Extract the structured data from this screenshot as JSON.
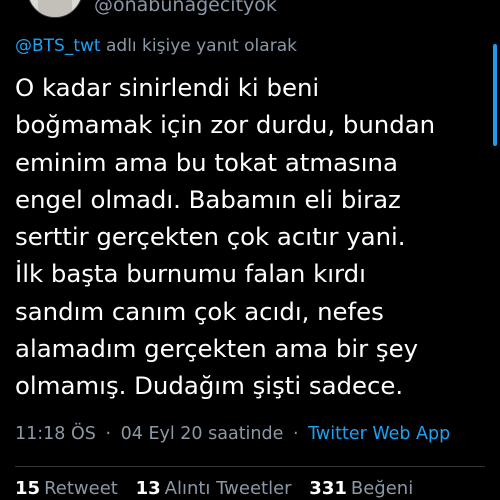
{
  "author": {
    "handle": "@onabunagecityok"
  },
  "reply": {
    "mention": "@BTS_twt",
    "suffix": " adlı kişiye yanıt olarak"
  },
  "tweet": {
    "lines": [
      "O kadar sinirlendi ki beni",
      "boğmamak için zor durdu, bundan",
      "eminim ama bu tokat atmasına",
      "engel olmadı. Babamın eli biraz",
      "serttir gerçekten çok acıtır yani.",
      "İlk başta burnumu falan kırdı",
      "sandım canım çok acıdı, nefes",
      "alamadım gerçekten ama bir şey",
      "olmamış. Dudağım şişti sadece."
    ]
  },
  "meta": {
    "time": "11:18 ÖS",
    "separator": "·",
    "date": "04 Eyl 20 saatinde",
    "source": "Twitter Web App"
  },
  "stats": {
    "retweets": {
      "count": "15",
      "label": "Retweet"
    },
    "quotes": {
      "count": "13",
      "label": "Alıntı Tweetler"
    },
    "likes": {
      "count": "331",
      "label": "Beğeni"
    }
  },
  "colors": {
    "background": "#000000",
    "text": "#ffffff",
    "muted": "#8b98a5",
    "accent": "#1da1f2"
  }
}
